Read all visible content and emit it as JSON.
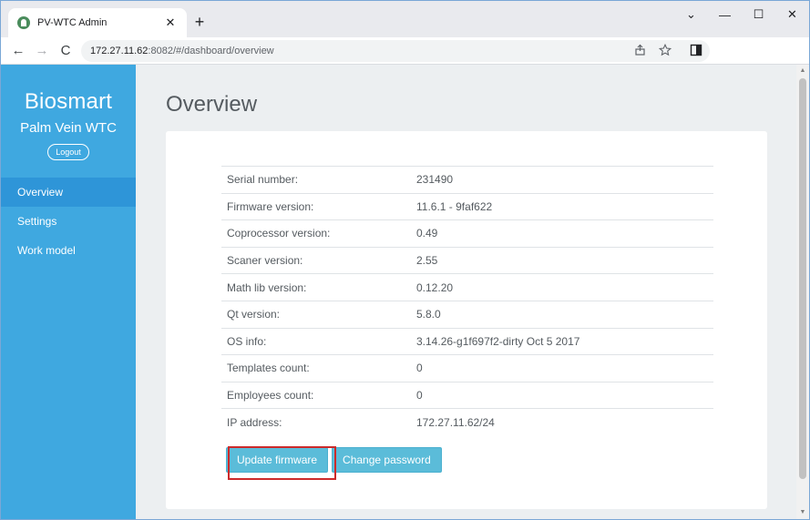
{
  "browser": {
    "tab_title": "PV-WTC Admin",
    "tab_close": "✕",
    "new_tab": "+",
    "window_controls": {
      "chevron": "⌄",
      "minimize": "—",
      "maximize": "☐",
      "close": "✕"
    },
    "nav": {
      "back": "←",
      "forward": "→",
      "reload": "C"
    },
    "url_host": "172.27.11.62",
    "url_path": ":8082/#/dashboard/overview",
    "icons": [
      "share-icon",
      "star-icon",
      "side-panel-icon"
    ]
  },
  "sidebar": {
    "brand": "Biosmart",
    "subtitle": "Palm Vein WTC",
    "logout_label": "Logout",
    "items": [
      {
        "label": "Overview",
        "active": true
      },
      {
        "label": "Settings",
        "active": false
      },
      {
        "label": "Work model",
        "active": false
      }
    ]
  },
  "main": {
    "title": "Overview",
    "info": [
      {
        "key": "Serial number:",
        "value": "231490"
      },
      {
        "key": "Firmware version:",
        "value": "11.6.1 - 9faf622"
      },
      {
        "key": "Coprocessor version:",
        "value": "0.49"
      },
      {
        "key": "Scaner version:",
        "value": "2.55"
      },
      {
        "key": "Math lib version:",
        "value": "0.12.20"
      },
      {
        "key": "Qt version:",
        "value": "5.8.0"
      },
      {
        "key": "OS info:",
        "value": "3.14.26-g1f697f2-dirty Oct 5 2017"
      },
      {
        "key": "Templates count:",
        "value": "0"
      },
      {
        "key": "Employees count:",
        "value": "0"
      },
      {
        "key": "IP address:",
        "value": "172.27.11.62/24"
      }
    ],
    "buttons": {
      "update_firmware": "Update firmware",
      "change_password": "Change password"
    }
  },
  "colors": {
    "sidebar": "#3fa8e0",
    "sidebar_active": "#2e95d8",
    "button": "#5bbcd9",
    "highlight": "#cc2a2a"
  }
}
